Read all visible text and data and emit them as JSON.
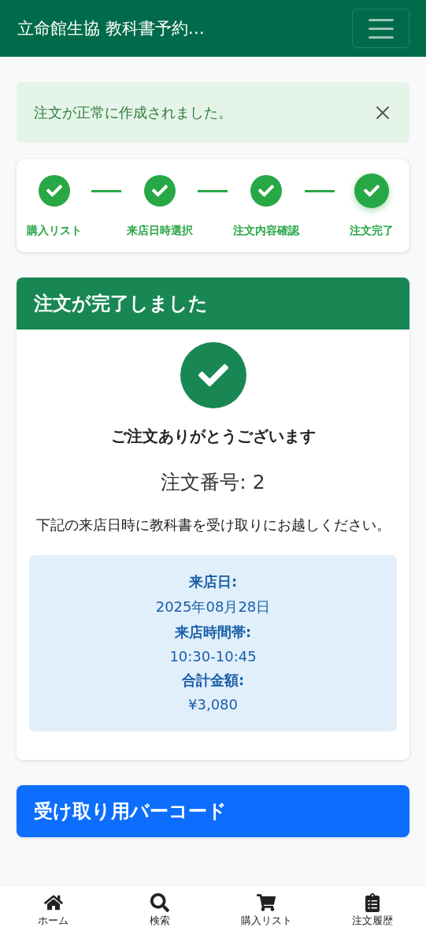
{
  "header": {
    "title": "立命館生協 教科書予約…"
  },
  "alert": {
    "message": "注文が正常に作成されました。"
  },
  "steps": [
    {
      "label": "購入リスト",
      "done": true,
      "selected": false
    },
    {
      "label": "来店日時選択",
      "done": true,
      "selected": false
    },
    {
      "label": "注文内容確認",
      "done": true,
      "selected": false
    },
    {
      "label": "注文完了",
      "done": true,
      "selected": true
    }
  ],
  "order_card": {
    "title": "注文が完了しました",
    "thanks": "ご注文ありがとうございます",
    "order_number": "注文番号: 2",
    "instruction": "下記の来店日時に教科書を受け取りにお越しください。",
    "details": [
      {
        "label": "来店日:",
        "value": "2025年08月28日"
      },
      {
        "label": "来店時間帯:",
        "value": "10:30-10:45"
      },
      {
        "label": "合計金額:",
        "value": "¥3,080"
      }
    ]
  },
  "barcode_card": {
    "title": "受け取り用バーコード"
  },
  "bottom_nav": [
    {
      "kind": "home",
      "label": "ホーム"
    },
    {
      "kind": "search",
      "label": "検索"
    },
    {
      "kind": "cart",
      "label": "購入リスト"
    },
    {
      "kind": "orders",
      "label": "注文履歴"
    }
  ]
}
